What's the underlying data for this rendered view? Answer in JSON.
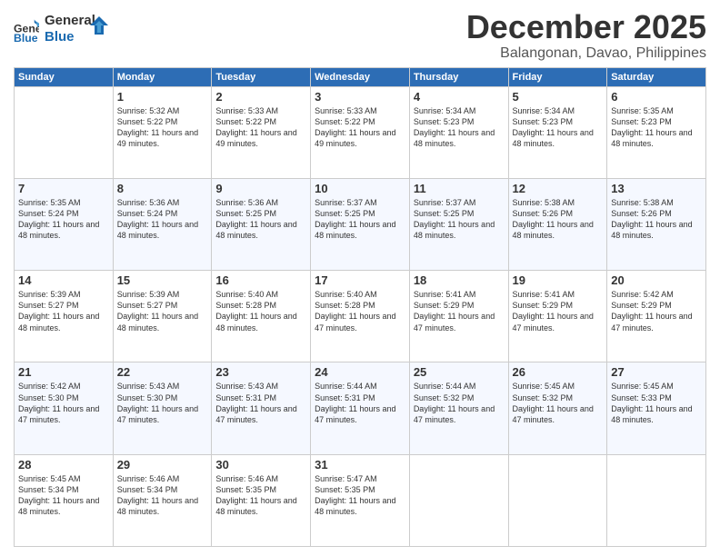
{
  "header": {
    "logo_line1": "General",
    "logo_line2": "Blue",
    "month": "December 2025",
    "location": "Balangonan, Davao, Philippines"
  },
  "days_of_week": [
    "Sunday",
    "Monday",
    "Tuesday",
    "Wednesday",
    "Thursday",
    "Friday",
    "Saturday"
  ],
  "weeks": [
    [
      {
        "day": "",
        "sunrise": "",
        "sunset": "",
        "daylight": ""
      },
      {
        "day": "1",
        "sunrise": "Sunrise: 5:32 AM",
        "sunset": "Sunset: 5:22 PM",
        "daylight": "Daylight: 11 hours and 49 minutes."
      },
      {
        "day": "2",
        "sunrise": "Sunrise: 5:33 AM",
        "sunset": "Sunset: 5:22 PM",
        "daylight": "Daylight: 11 hours and 49 minutes."
      },
      {
        "day": "3",
        "sunrise": "Sunrise: 5:33 AM",
        "sunset": "Sunset: 5:22 PM",
        "daylight": "Daylight: 11 hours and 49 minutes."
      },
      {
        "day": "4",
        "sunrise": "Sunrise: 5:34 AM",
        "sunset": "Sunset: 5:23 PM",
        "daylight": "Daylight: 11 hours and 48 minutes."
      },
      {
        "day": "5",
        "sunrise": "Sunrise: 5:34 AM",
        "sunset": "Sunset: 5:23 PM",
        "daylight": "Daylight: 11 hours and 48 minutes."
      },
      {
        "day": "6",
        "sunrise": "Sunrise: 5:35 AM",
        "sunset": "Sunset: 5:23 PM",
        "daylight": "Daylight: 11 hours and 48 minutes."
      }
    ],
    [
      {
        "day": "7",
        "sunrise": "Sunrise: 5:35 AM",
        "sunset": "Sunset: 5:24 PM",
        "daylight": "Daylight: 11 hours and 48 minutes."
      },
      {
        "day": "8",
        "sunrise": "Sunrise: 5:36 AM",
        "sunset": "Sunset: 5:24 PM",
        "daylight": "Daylight: 11 hours and 48 minutes."
      },
      {
        "day": "9",
        "sunrise": "Sunrise: 5:36 AM",
        "sunset": "Sunset: 5:25 PM",
        "daylight": "Daylight: 11 hours and 48 minutes."
      },
      {
        "day": "10",
        "sunrise": "Sunrise: 5:37 AM",
        "sunset": "Sunset: 5:25 PM",
        "daylight": "Daylight: 11 hours and 48 minutes."
      },
      {
        "day": "11",
        "sunrise": "Sunrise: 5:37 AM",
        "sunset": "Sunset: 5:25 PM",
        "daylight": "Daylight: 11 hours and 48 minutes."
      },
      {
        "day": "12",
        "sunrise": "Sunrise: 5:38 AM",
        "sunset": "Sunset: 5:26 PM",
        "daylight": "Daylight: 11 hours and 48 minutes."
      },
      {
        "day": "13",
        "sunrise": "Sunrise: 5:38 AM",
        "sunset": "Sunset: 5:26 PM",
        "daylight": "Daylight: 11 hours and 48 minutes."
      }
    ],
    [
      {
        "day": "14",
        "sunrise": "Sunrise: 5:39 AM",
        "sunset": "Sunset: 5:27 PM",
        "daylight": "Daylight: 11 hours and 48 minutes."
      },
      {
        "day": "15",
        "sunrise": "Sunrise: 5:39 AM",
        "sunset": "Sunset: 5:27 PM",
        "daylight": "Daylight: 11 hours and 48 minutes."
      },
      {
        "day": "16",
        "sunrise": "Sunrise: 5:40 AM",
        "sunset": "Sunset: 5:28 PM",
        "daylight": "Daylight: 11 hours and 48 minutes."
      },
      {
        "day": "17",
        "sunrise": "Sunrise: 5:40 AM",
        "sunset": "Sunset: 5:28 PM",
        "daylight": "Daylight: 11 hours and 47 minutes."
      },
      {
        "day": "18",
        "sunrise": "Sunrise: 5:41 AM",
        "sunset": "Sunset: 5:29 PM",
        "daylight": "Daylight: 11 hours and 47 minutes."
      },
      {
        "day": "19",
        "sunrise": "Sunrise: 5:41 AM",
        "sunset": "Sunset: 5:29 PM",
        "daylight": "Daylight: 11 hours and 47 minutes."
      },
      {
        "day": "20",
        "sunrise": "Sunrise: 5:42 AM",
        "sunset": "Sunset: 5:29 PM",
        "daylight": "Daylight: 11 hours and 47 minutes."
      }
    ],
    [
      {
        "day": "21",
        "sunrise": "Sunrise: 5:42 AM",
        "sunset": "Sunset: 5:30 PM",
        "daylight": "Daylight: 11 hours and 47 minutes."
      },
      {
        "day": "22",
        "sunrise": "Sunrise: 5:43 AM",
        "sunset": "Sunset: 5:30 PM",
        "daylight": "Daylight: 11 hours and 47 minutes."
      },
      {
        "day": "23",
        "sunrise": "Sunrise: 5:43 AM",
        "sunset": "Sunset: 5:31 PM",
        "daylight": "Daylight: 11 hours and 47 minutes."
      },
      {
        "day": "24",
        "sunrise": "Sunrise: 5:44 AM",
        "sunset": "Sunset: 5:31 PM",
        "daylight": "Daylight: 11 hours and 47 minutes."
      },
      {
        "day": "25",
        "sunrise": "Sunrise: 5:44 AM",
        "sunset": "Sunset: 5:32 PM",
        "daylight": "Daylight: 11 hours and 47 minutes."
      },
      {
        "day": "26",
        "sunrise": "Sunrise: 5:45 AM",
        "sunset": "Sunset: 5:32 PM",
        "daylight": "Daylight: 11 hours and 47 minutes."
      },
      {
        "day": "27",
        "sunrise": "Sunrise: 5:45 AM",
        "sunset": "Sunset: 5:33 PM",
        "daylight": "Daylight: 11 hours and 48 minutes."
      }
    ],
    [
      {
        "day": "28",
        "sunrise": "Sunrise: 5:45 AM",
        "sunset": "Sunset: 5:34 PM",
        "daylight": "Daylight: 11 hours and 48 minutes."
      },
      {
        "day": "29",
        "sunrise": "Sunrise: 5:46 AM",
        "sunset": "Sunset: 5:34 PM",
        "daylight": "Daylight: 11 hours and 48 minutes."
      },
      {
        "day": "30",
        "sunrise": "Sunrise: 5:46 AM",
        "sunset": "Sunset: 5:35 PM",
        "daylight": "Daylight: 11 hours and 48 minutes."
      },
      {
        "day": "31",
        "sunrise": "Sunrise: 5:47 AM",
        "sunset": "Sunset: 5:35 PM",
        "daylight": "Daylight: 11 hours and 48 minutes."
      },
      {
        "day": "",
        "sunrise": "",
        "sunset": "",
        "daylight": ""
      },
      {
        "day": "",
        "sunrise": "",
        "sunset": "",
        "daylight": ""
      },
      {
        "day": "",
        "sunrise": "",
        "sunset": "",
        "daylight": ""
      }
    ]
  ]
}
